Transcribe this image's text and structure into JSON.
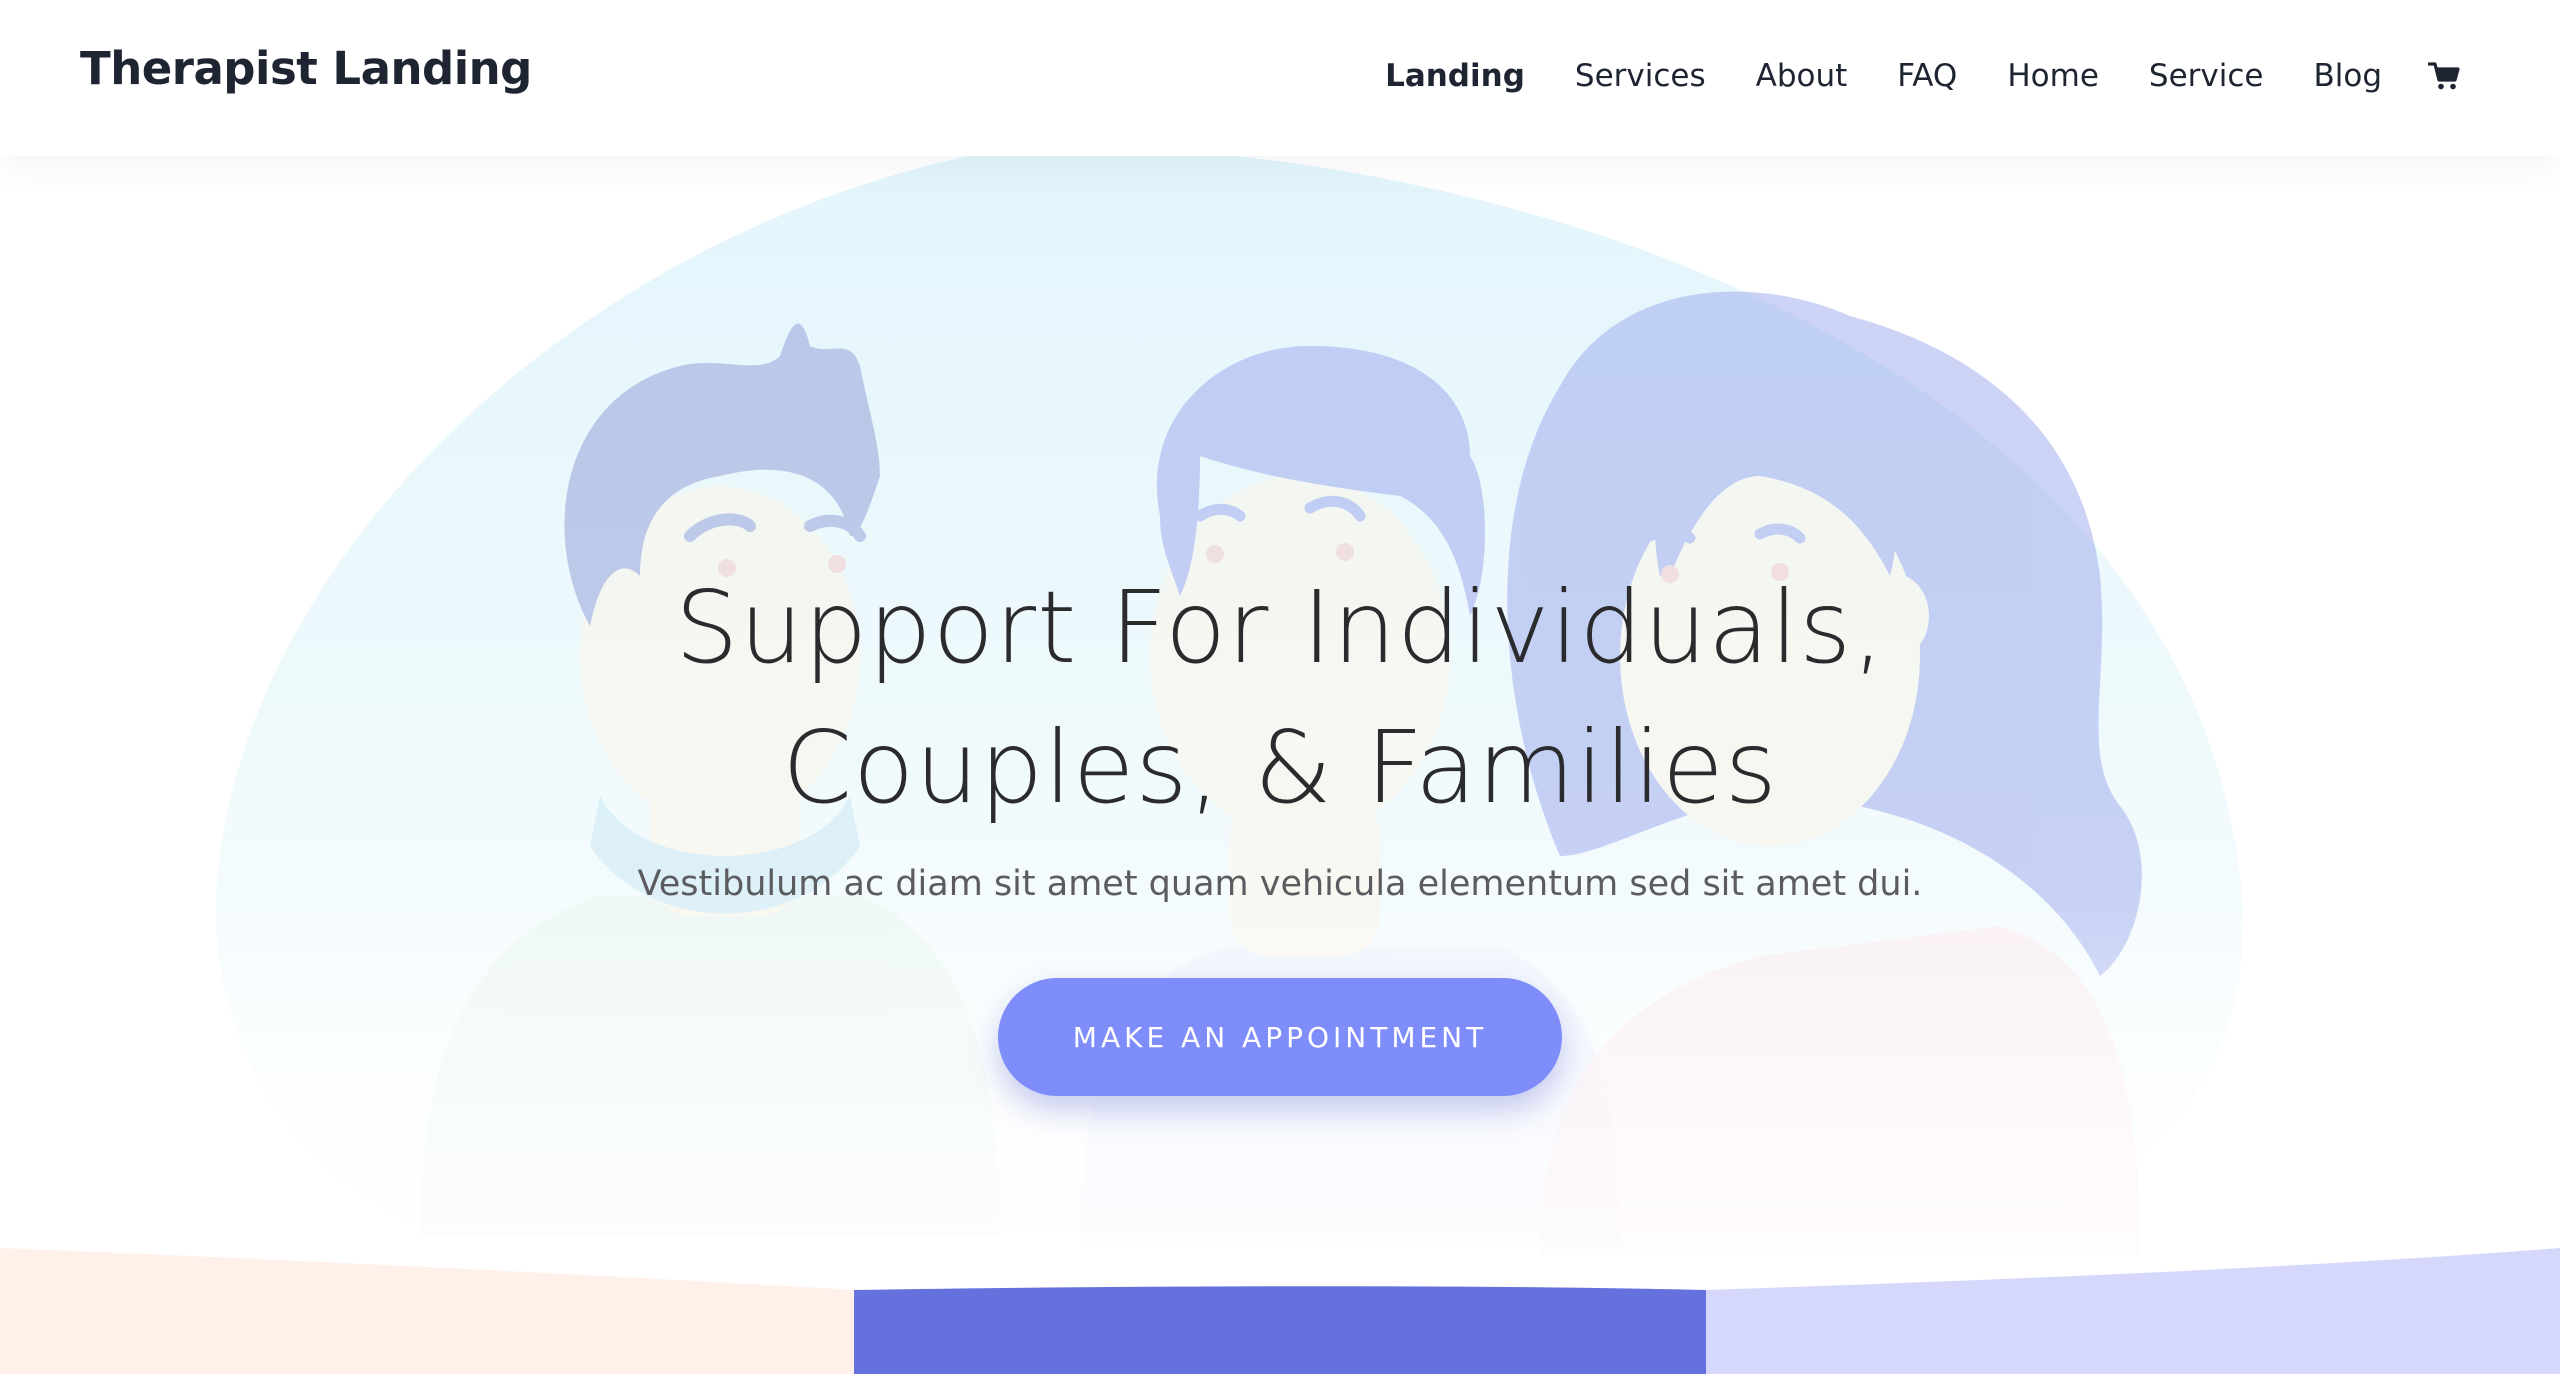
{
  "header": {
    "logo": "Therapist Landing",
    "nav": [
      {
        "label": "Landing",
        "active": true
      },
      {
        "label": "Services"
      },
      {
        "label": "About"
      },
      {
        "label": "FAQ"
      },
      {
        "label": "Home"
      },
      {
        "label": "Service"
      },
      {
        "label": "Blog"
      }
    ],
    "cart_icon": "shopping-cart-icon"
  },
  "hero": {
    "title_line1": "Support For Individuals,",
    "title_line2": "Couples, & Families",
    "subtitle": "Vestibulum ac diam sit amet quam vehicula elementum sed sit amet dui.",
    "cta_label": "MAKE AN APPOINTMENT",
    "illustration": "three-people-illustration"
  },
  "colors": {
    "accent": "#7f8dfb",
    "text_dark": "#1e2431",
    "strip_left": "#fff0ea",
    "strip_middle": "#6571dd",
    "strip_right": "#d5d8fb"
  }
}
